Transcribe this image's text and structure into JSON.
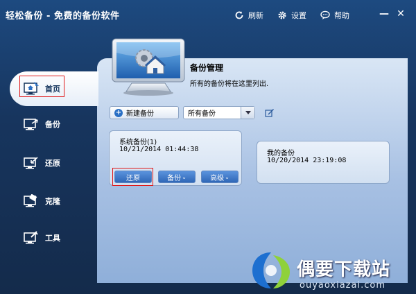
{
  "window": {
    "title": "轻松备份 - 免费的备份软件",
    "actions": [
      {
        "label": "刷新",
        "icon": "refresh-icon"
      },
      {
        "label": "设置",
        "icon": "gear-icon"
      },
      {
        "label": "帮助",
        "icon": "help-icon"
      }
    ],
    "minimize": "—",
    "close": "✕"
  },
  "sidebar": {
    "items": [
      {
        "label": "首页",
        "icon": "home-icon",
        "active": true
      },
      {
        "label": "备份",
        "icon": "backup-icon"
      },
      {
        "label": "还原",
        "icon": "restore-icon"
      },
      {
        "label": "克隆",
        "icon": "clone-icon"
      },
      {
        "label": "工具",
        "icon": "tools-icon"
      }
    ]
  },
  "main": {
    "title": "备份管理",
    "description": "所有的备份将在这里列出.",
    "new_backup_label": "新建备份",
    "filter_selected": "所有备份",
    "backups": [
      {
        "name": "系统备份(1)",
        "date": "10/21/2014 01:44:38"
      },
      {
        "name": "我的备份",
        "date": "10/20/2014 23:19:08"
      }
    ],
    "card_actions": {
      "restore": "还原",
      "backup": "备份",
      "advanced": "高级"
    }
  },
  "watermark": {
    "brand": "偶要下载站",
    "url": "ouyaoxiazai.com"
  },
  "colors": {
    "accent": "#2a6fc4",
    "highlight": "#e01818",
    "background": "#17355e"
  }
}
